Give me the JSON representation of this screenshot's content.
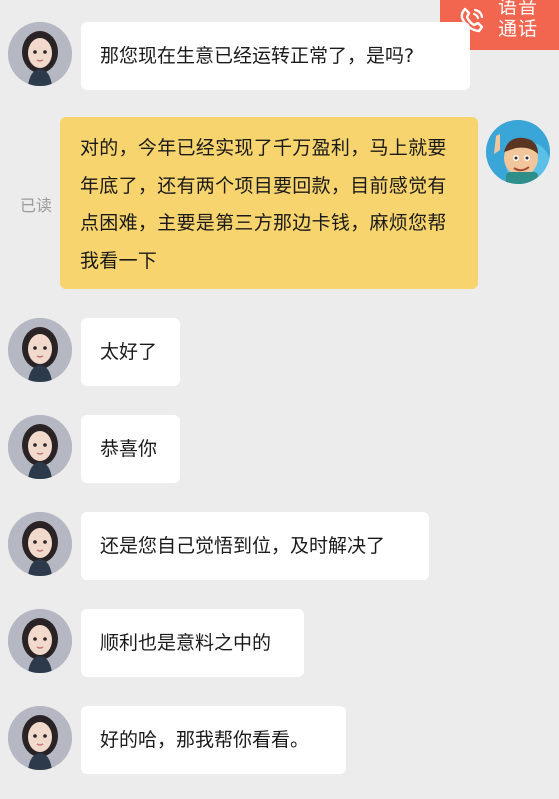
{
  "voice_call": {
    "label_line1": "语音",
    "label_line2": "通话",
    "icon": "phone-icon"
  },
  "read_status": "已读",
  "colors": {
    "background": "#ececec",
    "incoming_bubble": "#ffffff",
    "outgoing_bubble": "#f7d46d",
    "voice_button": "#f2654e",
    "read_text": "#9b9b9b"
  },
  "messages": [
    {
      "sender": "other",
      "text": "那您现在生意已经运转正常了，是吗?"
    },
    {
      "sender": "me",
      "text": "对的，今年已经实现了千万盈利，马上就要年底了，还有两个项目要回款，目前感觉有点困难，主要是第三方那边卡钱，麻烦您帮我看一下"
    },
    {
      "sender": "other",
      "text": "太好了"
    },
    {
      "sender": "other",
      "text": "恭喜你"
    },
    {
      "sender": "other",
      "text": "还是您自己觉悟到位，及时解决了"
    },
    {
      "sender": "other",
      "text": "顺利也是意料之中的"
    },
    {
      "sender": "other",
      "text": "好的哈，那我帮你看看。"
    }
  ]
}
